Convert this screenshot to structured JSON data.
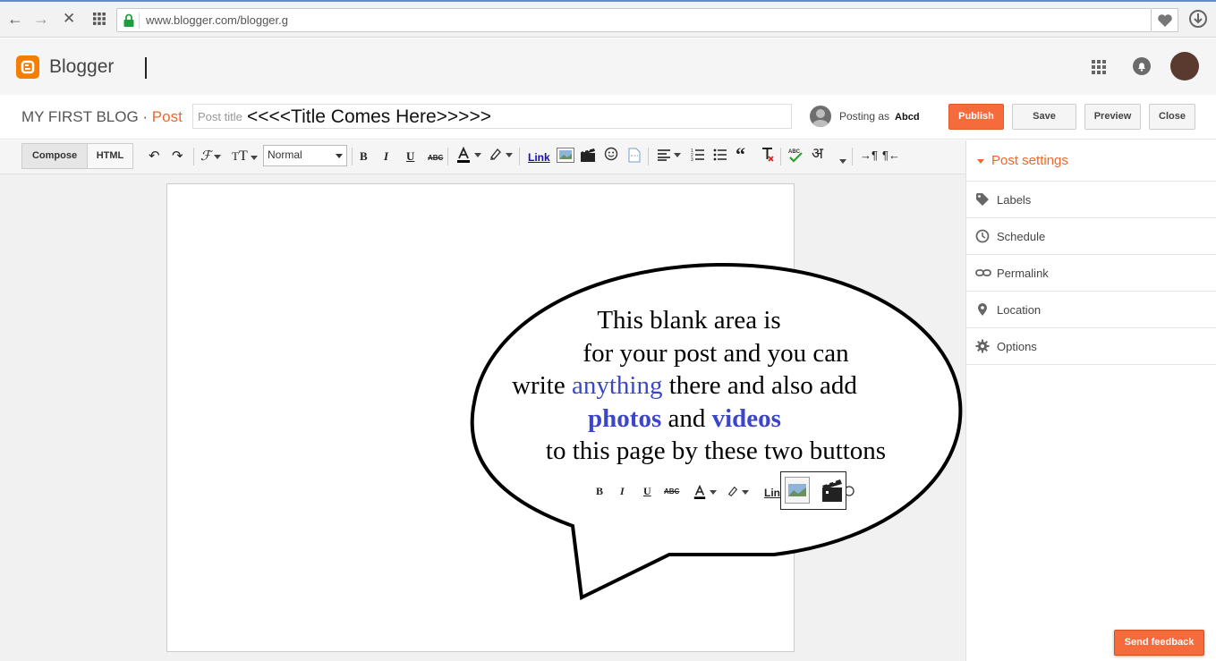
{
  "browser": {
    "url": "www.blogger.com/blogger.g",
    "colors": {
      "lock": "#1f9f3c"
    }
  },
  "header": {
    "app_name": "Blogger",
    "icons": [
      "apps-grid-icon",
      "notifications-bell-icon",
      "account-avatar"
    ]
  },
  "post_bar": {
    "blog_name": "MY FIRST BLOG",
    "separator": " · ",
    "section": "Post",
    "title_placeholder": "Post title",
    "title_value": "<<<<Title Comes Here>>>>>",
    "posting_as_label": "Posting as",
    "posting_as_name": "Abcd",
    "buttons": {
      "publish": "Publish",
      "save": "Save",
      "preview": "Preview",
      "close": "Close"
    }
  },
  "toolbar": {
    "compose": "Compose",
    "html": "HTML",
    "format": "Normal",
    "bold": "B",
    "italic": "I",
    "underline": "U",
    "strike": "ABC",
    "link": "Link",
    "hindi": "अ"
  },
  "sidebar": {
    "title": "Post settings",
    "items": [
      {
        "label": "Labels",
        "icon": "tag-icon"
      },
      {
        "label": "Schedule",
        "icon": "clock-icon"
      },
      {
        "label": "Permalink",
        "icon": "link-icon"
      },
      {
        "label": "Location",
        "icon": "location-pin-icon"
      },
      {
        "label": "Options",
        "icon": "gear-icon"
      }
    ]
  },
  "callout": {
    "line1": "This blank area is",
    "line2": "for your post and you can",
    "line3_a": "write ",
    "line3_b": "anything",
    "line3_c": " there and also add",
    "line4_a": "photos",
    "line4_b": " and ",
    "line4_c": "videos",
    "line5": "to this page by these two buttons",
    "mini_link": "Lin",
    "highlight_color": "#3b47c8"
  },
  "feedback": {
    "label": "Send feedback"
  },
  "colors": {
    "accent": "#f0672b",
    "publish": "#f56b3c"
  }
}
